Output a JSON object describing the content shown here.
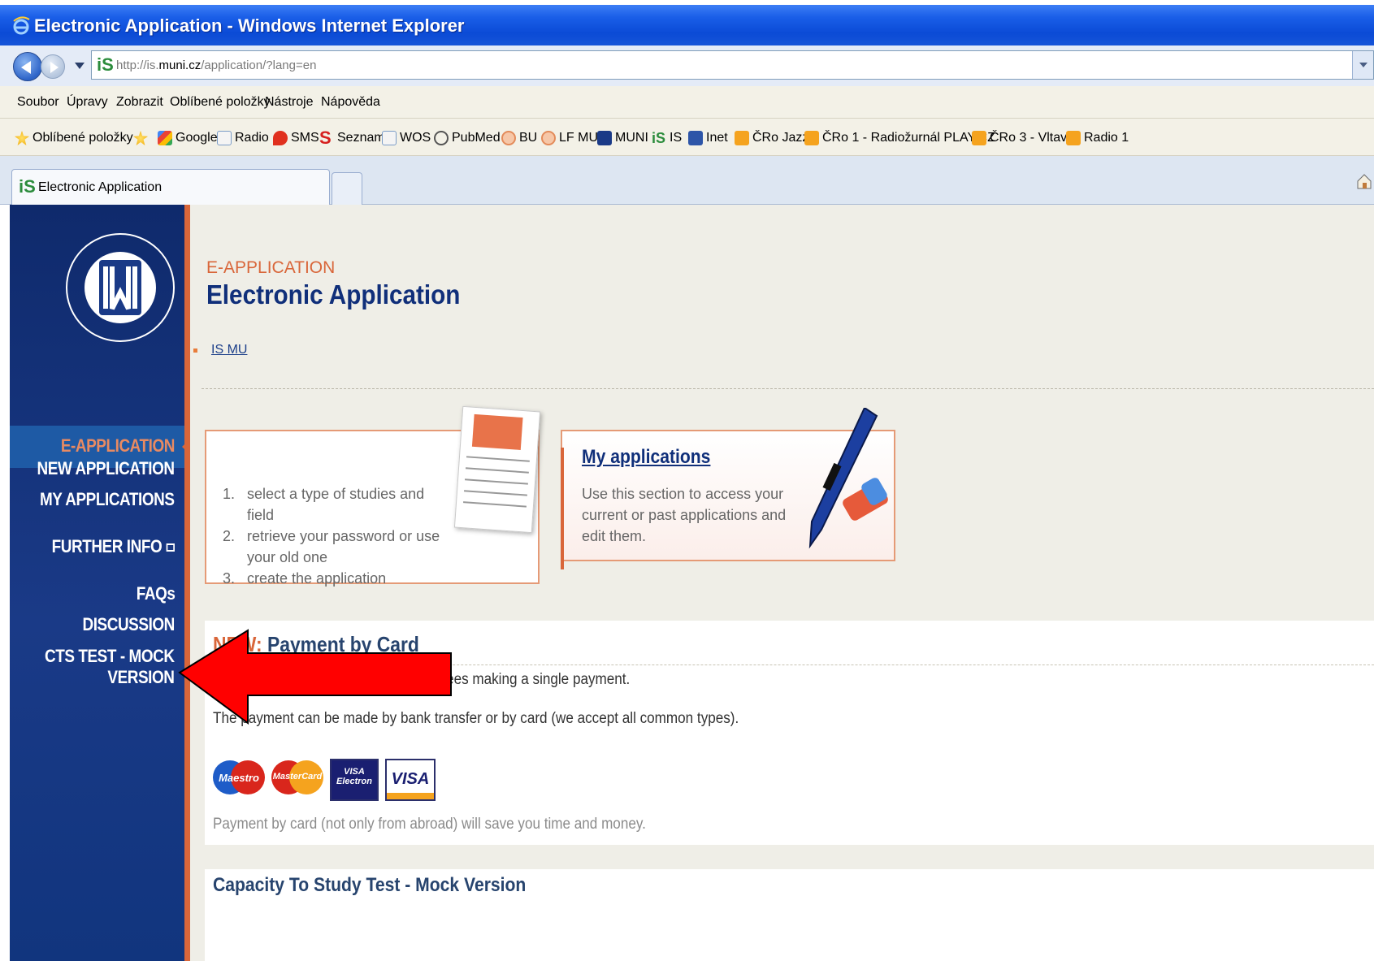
{
  "window": {
    "title": "Electronic Application - Windows Internet Explorer"
  },
  "addressbar": {
    "url_prefix": "http://is.",
    "url_domain": "muni.cz",
    "url_path": "/application/?lang=en"
  },
  "menubar": {
    "items": [
      "Soubor",
      "Úpravy",
      "Zobrazit",
      "Oblíbené položky",
      "Nástroje",
      "Nápověda"
    ]
  },
  "favorites": {
    "label": "Oblíbené položky",
    "items": [
      {
        "label": "Google",
        "icon": "google-icon"
      },
      {
        "label": "Radio",
        "icon": "ie-page-icon"
      },
      {
        "label": "SMS",
        "icon": "drop-icon"
      },
      {
        "label": "Seznam",
        "icon": "seznam-icon"
      },
      {
        "label": "WOS",
        "icon": "ie-page-icon"
      },
      {
        "label": "PubMed",
        "icon": "pubmed-icon"
      },
      {
        "label": "BU",
        "icon": "gear-icon"
      },
      {
        "label": "LF MU",
        "icon": "gear-icon"
      },
      {
        "label": "MUNI",
        "icon": "muni-icon"
      },
      {
        "label": "IS",
        "icon": "is-icon"
      },
      {
        "label": "Inet",
        "icon": "info-icon"
      },
      {
        "label": "ČRo Jazz",
        "icon": "rss-icon"
      },
      {
        "label": "ČRo 1 - Radiožurnál PLAY.CZ",
        "icon": "rss-icon"
      },
      {
        "label": "ČRo 3 - Vltava",
        "icon": "rss-icon"
      },
      {
        "label": "Radio 1",
        "icon": "rss-icon"
      }
    ]
  },
  "tab": {
    "label": "Electronic Application"
  },
  "sidebar": {
    "active": "E-APPLICATION",
    "items": [
      "NEW APPLICATION",
      "MY APPLICATIONS",
      "FURTHER INFO",
      "FAQs",
      "DISCUSSION",
      "CTS TEST - MOCK",
      "VERSION"
    ]
  },
  "header": {
    "kicker": "E-APPLICATION",
    "title": "Electronic Application",
    "breadcrumb": "IS MU"
  },
  "new_application_card": {
    "steps": [
      {
        "n": "1.",
        "text": "select a type of studies and field"
      },
      {
        "n": "2.",
        "text": "retrieve your password or use your old one"
      },
      {
        "n": "3.",
        "text": "create the application"
      }
    ]
  },
  "my_applications_card": {
    "title": "My applications",
    "text": "Use this section to access your current or past applications and edit them."
  },
  "payment": {
    "title_new": "NEW:",
    "title": "Payment by Card",
    "p1": "Now you can pay all your application fees making a single payment.",
    "p2": "The payment can be made by bank transfer or by card (we accept all common types).",
    "note": "Payment by card (not only from abroad) will save you time and money.",
    "card_logos": [
      "Maestro",
      "MasterCard",
      "VISA Electron",
      "VISA"
    ]
  },
  "cts": {
    "title": "Capacity To Study Test - Mock Version"
  },
  "colors": {
    "sidebar_bg": "#1a3a87",
    "accent_orange": "#d9663a",
    "title_blue": "#102f7a",
    "annotation_red": "#ff0000"
  }
}
